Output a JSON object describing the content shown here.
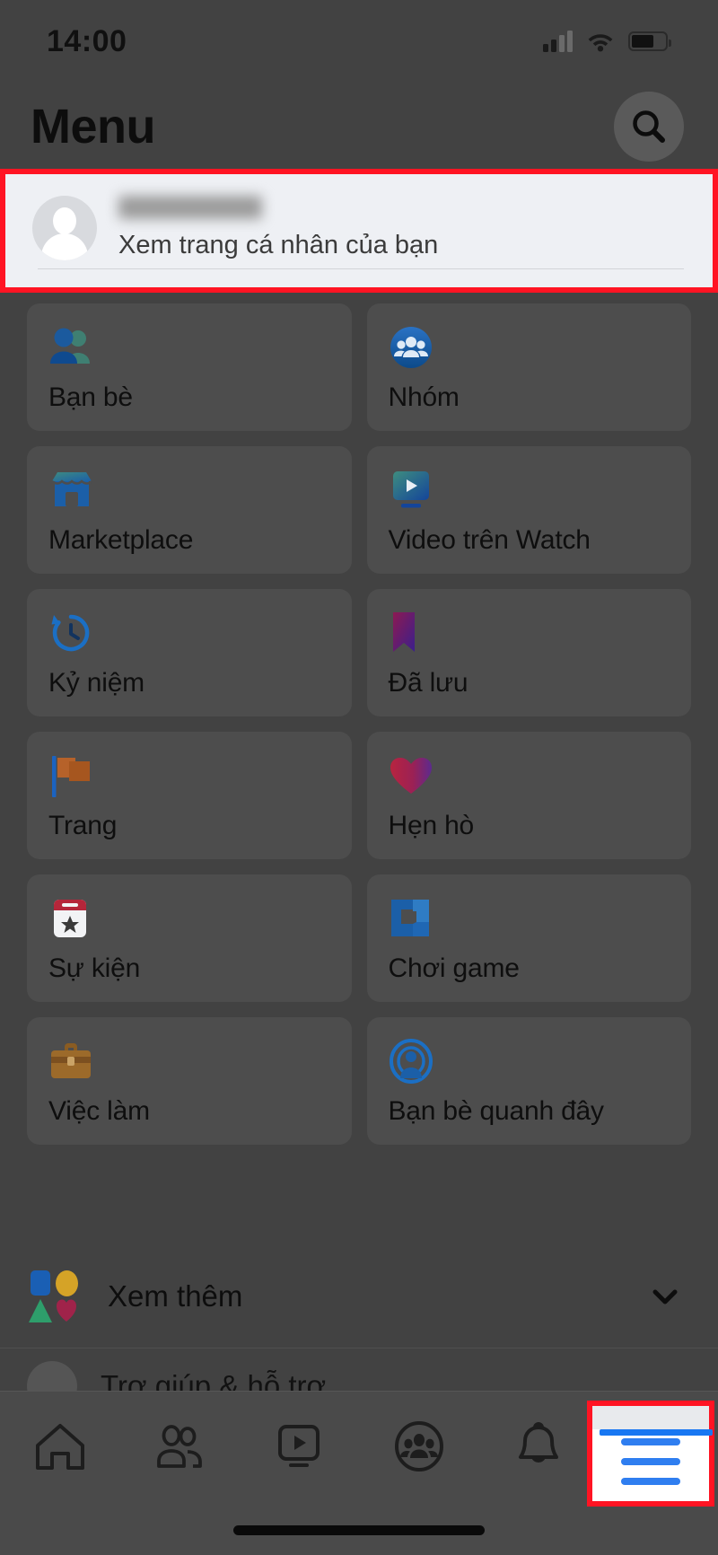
{
  "status_bar": {
    "time": "14:00",
    "icons": [
      "cellular-signal-icon",
      "wifi-icon",
      "battery-icon"
    ]
  },
  "header": {
    "title": "Menu",
    "search_icon": "search-icon"
  },
  "profile": {
    "name": "",
    "name_blurred": true,
    "subtitle": "Xem trang cá nhân của bạn",
    "avatar_icon": "default-avatar-icon",
    "highlight_color": "#ff1423"
  },
  "grid": {
    "tiles": [
      {
        "label": "Bạn bè",
        "icon": "friends-icon"
      },
      {
        "label": "Nhóm",
        "icon": "groups-icon"
      },
      {
        "label": "Marketplace",
        "icon": "marketplace-icon"
      },
      {
        "label": "Video trên Watch",
        "icon": "watch-video-icon"
      },
      {
        "label": "Kỷ niệm",
        "icon": "memories-clock-icon"
      },
      {
        "label": "Đã lưu",
        "icon": "saved-bookmark-icon"
      },
      {
        "label": "Trang",
        "icon": "pages-flag-icon"
      },
      {
        "label": "Hẹn hò",
        "icon": "dating-heart-icon"
      },
      {
        "label": "Sự kiện",
        "icon": "events-calendar-icon"
      },
      {
        "label": "Chơi game",
        "icon": "gaming-icon"
      },
      {
        "label": "Việc làm",
        "icon": "jobs-briefcase-icon"
      },
      {
        "label": "Bạn bè quanh đây",
        "icon": "nearby-friends-icon"
      }
    ]
  },
  "see_more": {
    "label": "Xem thêm",
    "icon": "shapes-grid-icon",
    "chevron": "chevron-down-icon"
  },
  "peeked_row": {
    "label": "Trợ giúp & hỗ trợ"
  },
  "bottom_nav": {
    "items": [
      {
        "name": "home",
        "icon": "home-icon",
        "active": false
      },
      {
        "name": "friends",
        "icon": "friends-nav-icon",
        "active": false
      },
      {
        "name": "watch",
        "icon": "watch-nav-icon",
        "active": false
      },
      {
        "name": "groups",
        "icon": "groups-nav-icon",
        "active": false
      },
      {
        "name": "notifications",
        "icon": "bell-icon",
        "active": false
      },
      {
        "name": "menu",
        "icon": "hamburger-menu-icon",
        "active": true
      }
    ],
    "active_highlight_color": "#ff1423",
    "active_accent_color": "#1877f2"
  },
  "theme": {
    "page_background": "#424242",
    "tile_background": "#4d4d4d",
    "nav_background": "#4a4a4a",
    "highlight": "#ff1423"
  }
}
